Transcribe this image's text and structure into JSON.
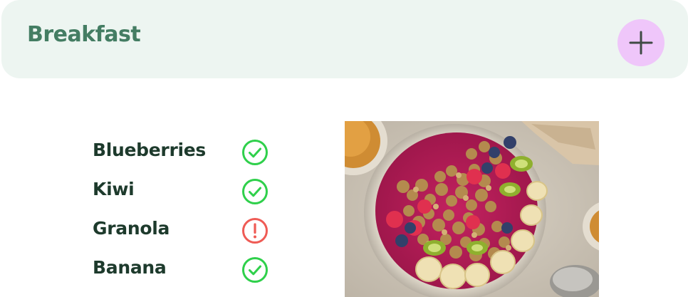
{
  "header": {
    "title": "Breakfast",
    "add_button_icon": "plus-icon",
    "background_color": "#edf5f1",
    "title_color": "#447d63",
    "add_button_color": "#efc6fa"
  },
  "ingredients": [
    {
      "label": "Blueberries",
      "status": "ok",
      "status_icon": "check-circle-icon"
    },
    {
      "label": "Kiwi",
      "status": "ok",
      "status_icon": "check-circle-icon"
    },
    {
      "label": "Granola",
      "status": "warning",
      "status_icon": "alert-circle-icon"
    },
    {
      "label": "Banana",
      "status": "ok",
      "status_icon": "check-circle-icon"
    }
  ],
  "colors": {
    "ok": "#2fd04b",
    "warning": "#ef5b55",
    "label": "#1d3a2c"
  },
  "photo": {
    "subject": "smoothie bowl"
  }
}
